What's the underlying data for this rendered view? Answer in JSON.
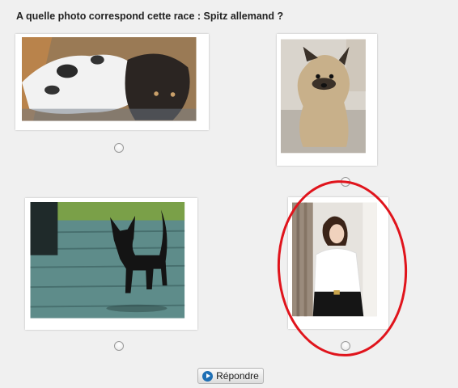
{
  "quiz": {
    "question": "A quelle photo correspond cette race : Spitz allemand ?",
    "options": [
      {
        "photo_subject": "dog lying in a basket"
      },
      {
        "photo_subject": "fluffy dog sitting"
      },
      {
        "photo_subject": "small black dog on wooden deck"
      },
      {
        "photo_subject": "woman in white blouse"
      }
    ],
    "submit_label": "Répondre",
    "highlight_color": "#e0141c"
  }
}
